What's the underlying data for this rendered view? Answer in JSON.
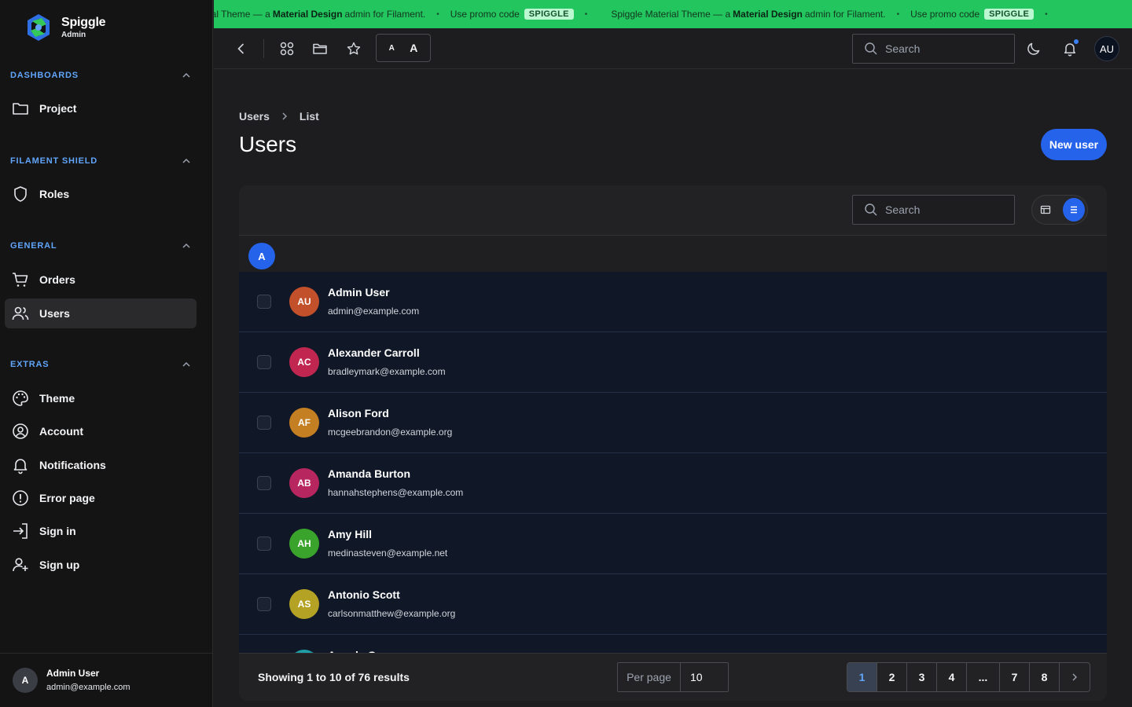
{
  "brand": {
    "name": "Spiggle",
    "subtitle": "Admin"
  },
  "sidebar": {
    "groups": [
      {
        "title": "DASHBOARDS",
        "items": [
          {
            "label": "Project",
            "icon": "folder-icon"
          }
        ]
      },
      {
        "title": "FILAMENT SHIELD",
        "items": [
          {
            "label": "Roles",
            "icon": "shield-icon"
          }
        ]
      },
      {
        "title": "GENERAL",
        "items": [
          {
            "label": "Orders",
            "icon": "cart-icon"
          },
          {
            "label": "Users",
            "icon": "users-icon",
            "active": true
          }
        ]
      },
      {
        "title": "EXTRAS",
        "items": [
          {
            "label": "Theme",
            "icon": "palette-icon"
          },
          {
            "label": "Account",
            "icon": "user-circle-icon"
          },
          {
            "label": "Notifications",
            "icon": "bell-icon"
          },
          {
            "label": "Error page",
            "icon": "alert-circle-icon"
          },
          {
            "label": "Sign in",
            "icon": "sign-in-icon"
          },
          {
            "label": "Sign up",
            "icon": "user-plus-icon"
          }
        ]
      }
    ],
    "user": {
      "initial": "A",
      "name": "Admin User",
      "email": "admin@example.com"
    }
  },
  "promo": {
    "lead_partial": "terial Theme — a",
    "text_a": "Spiggle Material Theme — a",
    "bold": "Material Design",
    "text_b": "admin for Filament.",
    "promo_text": "Use promo code",
    "code": "SPIGGLE",
    "dot": "•"
  },
  "topbar": {
    "font_small": "A",
    "font_large": "A",
    "search_placeholder": "Search",
    "avatar": "AU"
  },
  "page": {
    "breadcrumb": [
      "Users",
      "List"
    ],
    "title": "Users",
    "new_button": "New user"
  },
  "table": {
    "search_placeholder": "Search",
    "group_letter": "A",
    "rows": [
      {
        "initials": "AU",
        "name": "Admin User",
        "email": "admin@example.com",
        "color": "#c2502a"
      },
      {
        "initials": "AC",
        "name": "Alexander Carroll",
        "email": "bradleymark@example.com",
        "color": "#c0264f"
      },
      {
        "initials": "AF",
        "name": "Alison Ford",
        "email": "mcgeebrandon@example.org",
        "color": "#c47f22"
      },
      {
        "initials": "AB",
        "name": "Amanda Burton",
        "email": "hannahstephens@example.com",
        "color": "#b8265f"
      },
      {
        "initials": "AH",
        "name": "Amy Hill",
        "email": "medinasteven@example.net",
        "color": "#3aa32c"
      },
      {
        "initials": "AS",
        "name": "Antonio Scott",
        "email": "carlsonmatthew@example.org",
        "color": "#b3a224"
      },
      {
        "initials": "AG",
        "name": "Angela G",
        "email": "",
        "color": "#1f9ea6"
      }
    ],
    "footer": {
      "showing": "Showing 1 to 10 of 76 results",
      "per_page_label": "Per page",
      "per_page_value": "10",
      "pages": [
        "1",
        "2",
        "3",
        "4",
        "...",
        "7",
        "8"
      ],
      "active_page": "1"
    }
  },
  "colors": {
    "accent": "#2563eb",
    "promo": "#22c55e",
    "group_title": "#60a5fa"
  }
}
